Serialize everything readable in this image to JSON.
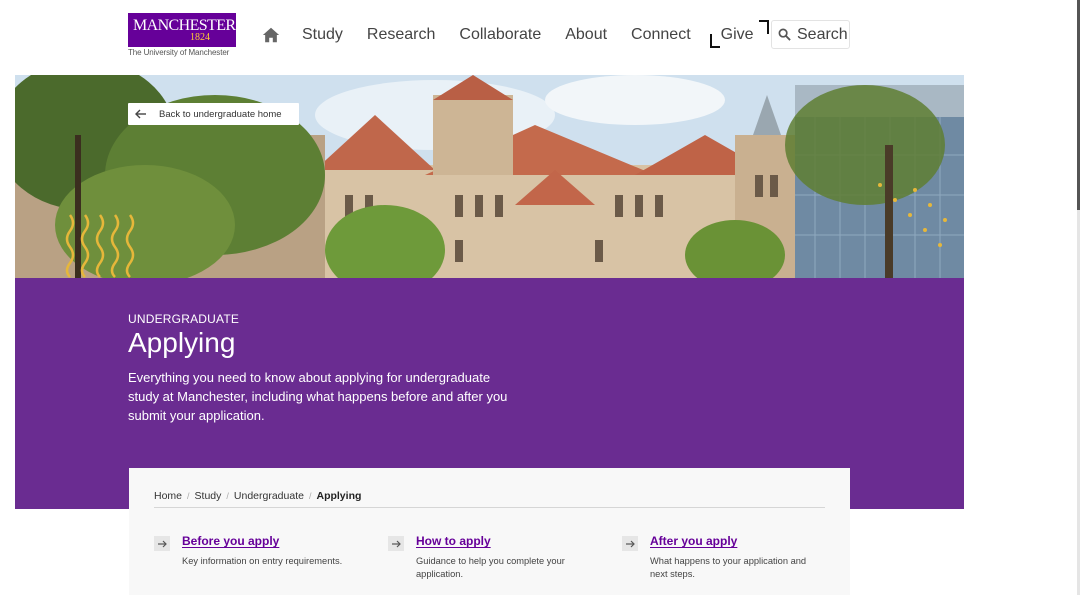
{
  "header": {
    "logo": {
      "wordmark": "MANCHESTER",
      "year": "1824",
      "subtitle": "The University of Manchester"
    },
    "nav": [
      "Study",
      "Research",
      "Collaborate",
      "About",
      "Connect",
      "Give"
    ],
    "home_icon": "home-icon",
    "search": {
      "label": "Search",
      "icon": "search-icon"
    }
  },
  "hero": {
    "back_label": "Back to undergraduate home",
    "back_icon": "arrow-left-icon"
  },
  "banner": {
    "eyebrow": "UNDERGRADUATE",
    "title": "Applying",
    "intro": "Everything you need to know about applying for undergraduate study at Manchester, including what happens before and after you submit your application.",
    "color": "#6a2c91"
  },
  "breadcrumb": [
    "Home",
    "Study",
    "Undergraduate",
    "Applying"
  ],
  "links": [
    {
      "title": "Before you apply",
      "desc": "Key information on entry requirements."
    },
    {
      "title": "How to apply",
      "desc": "Guidance to help you complete your application."
    },
    {
      "title": "After you apply",
      "desc": "What happens to your application and next steps."
    }
  ],
  "colors": {
    "brand_purple": "#660099",
    "gold": "#ffcc33"
  }
}
